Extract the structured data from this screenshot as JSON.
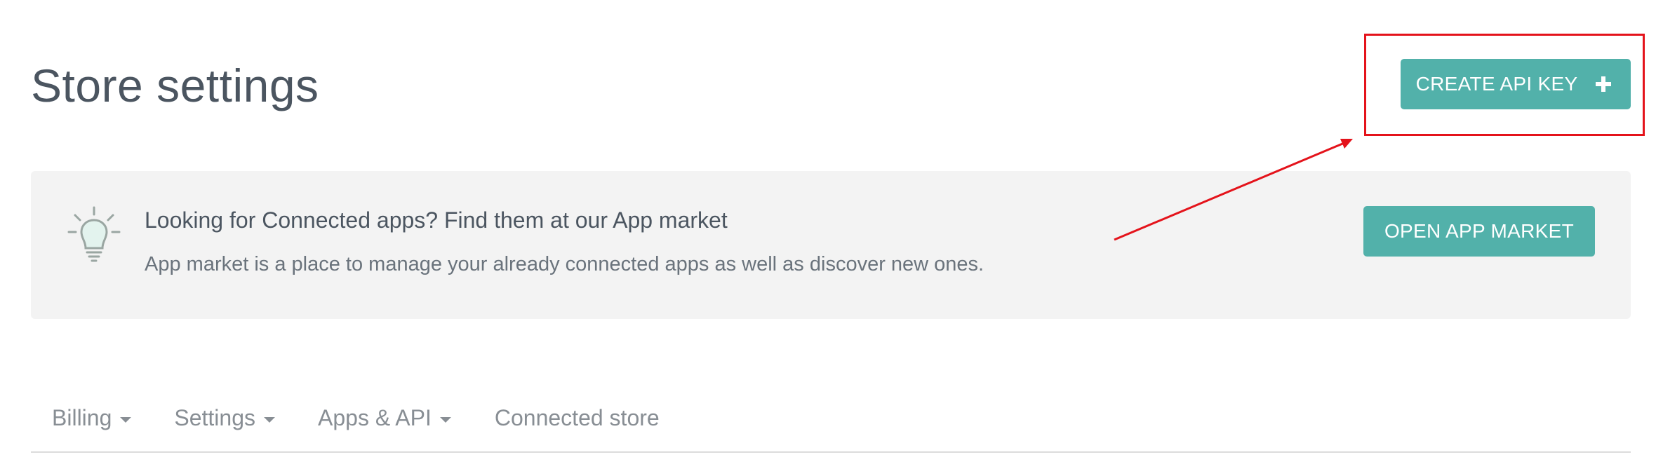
{
  "page_title": "Store settings",
  "header": {
    "create_api_key_label": "CREATE API KEY",
    "create_api_key_icon": "plus-icon"
  },
  "banner": {
    "icon": "lightbulb-icon",
    "heading": "Looking for Connected apps? Find them at our App market",
    "text": "App market is a place to manage your already connected apps as well as discover new ones.",
    "button_label": "OPEN APP MARKET"
  },
  "tabs": [
    {
      "label": "Billing",
      "has_dropdown": true
    },
    {
      "label": "Settings",
      "has_dropdown": true
    },
    {
      "label": "Apps & API",
      "has_dropdown": true
    },
    {
      "label": "Connected store",
      "has_dropdown": false
    }
  ],
  "colors": {
    "accent": "#52b1aa",
    "annotation": "#e4131b",
    "banner_bg": "#f3f3f3",
    "title_text": "#4b5560"
  }
}
